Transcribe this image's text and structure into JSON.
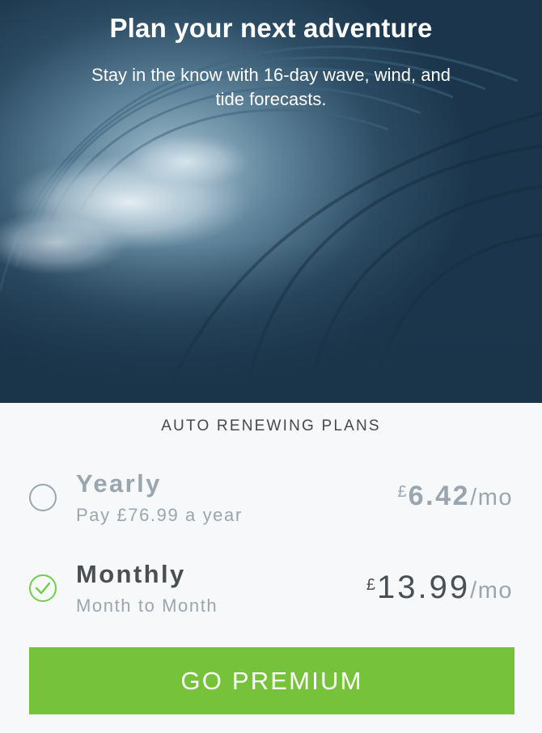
{
  "hero": {
    "title": "Plan your next adventure",
    "subtitle": "Stay in the know with 16-day wave, wind, and tide forecasts.",
    "image": "ocean-wave-barrel-photo"
  },
  "plans": {
    "heading": "AUTO RENEWING PLANS",
    "items": [
      {
        "name": "Yearly",
        "description": "Pay £76.99 a year",
        "currency": "£",
        "price": "6.42",
        "unit": "/mo",
        "selected": false
      },
      {
        "name": "Monthly",
        "description": "Month to Month",
        "currency": "£",
        "price": "13.99",
        "unit": "/mo",
        "selected": true
      }
    ]
  },
  "cta": {
    "label": "GO PREMIUM"
  },
  "colors": {
    "accent_green": "#76c23a",
    "check_green": "#6fcf4a",
    "muted_gray": "#9aa6ae",
    "dark_text": "#4a4f54",
    "background": "#f7f8f9"
  }
}
